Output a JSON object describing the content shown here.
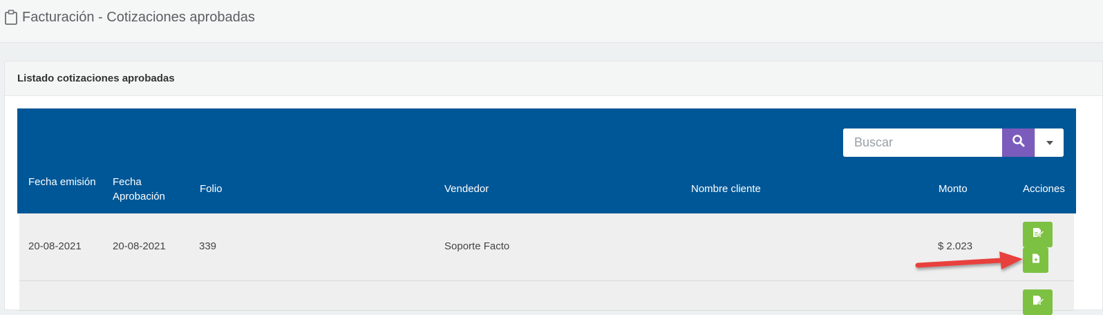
{
  "page": {
    "title": "Facturación - Cotizaciones aprobadas",
    "title_icon": "clipboard-icon"
  },
  "panel": {
    "title": "Listado cotizaciones aprobadas"
  },
  "search": {
    "placeholder": "Buscar",
    "search_icon": "search-icon",
    "dropdown_icon": "caret-down-icon"
  },
  "table": {
    "columns": {
      "fecha_emision": "Fecha emisión",
      "fecha_aprobacion": "Fecha Aprobación",
      "folio": "Folio",
      "vendedor": "Vendedor",
      "nombre_cliente": "Nombre cliente",
      "monto": "Monto",
      "acciones": "Acciones"
    },
    "rows": [
      {
        "fecha_emision": "20-08-2021",
        "fecha_aprobacion": "20-08-2021",
        "folio": "339",
        "vendedor": "Soporte Facto",
        "nombre_cliente": "",
        "monto": "$ 2.023",
        "actions": [
          "edit-document-icon",
          "new-document-icon"
        ]
      },
      {
        "fecha_emision": "",
        "fecha_aprobacion": "",
        "folio": "",
        "vendedor": "",
        "nombre_cliente": "",
        "monto": "",
        "actions": [
          "edit-document-icon"
        ]
      }
    ]
  },
  "colors": {
    "table_header_bg": "#005797",
    "search_button_bg": "#7b5cbd",
    "action_button_bg": "#7dc142",
    "row_bg": "#efefef",
    "annotation_arrow": "#e8413c"
  }
}
